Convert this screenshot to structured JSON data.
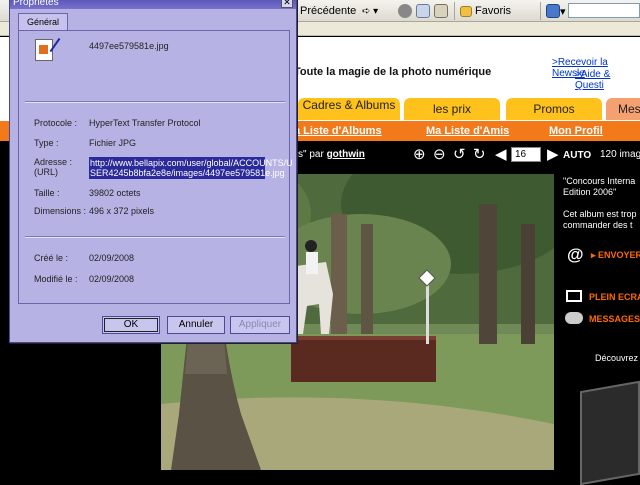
{
  "browser": {
    "back_label": "Précédente",
    "favorites_label": "Favoris"
  },
  "page": {
    "tagline": "Toute la magie de la photo numérique",
    "top_links": [
      ">Recevoir la Newsle",
      ">Aide & Questi"
    ],
    "tabs": [
      "Cadres & Albums",
      "les prix",
      "Promos",
      "Mes"
    ],
    "orange_links": [
      "a Liste d'Albums",
      "Ma Liste d'Amis",
      "Mon Profil"
    ],
    "viewer": {
      "by_prefix": "s\" par",
      "author": "gothwin",
      "page_number": "16",
      "auto_label": "AUTO",
      "image_count": "120 imag"
    },
    "right_panel": {
      "title_lines": [
        "\"Concours Interna",
        "Edition 2006\""
      ],
      "desc_lines": [
        "Cet album est trop",
        "commander des t"
      ],
      "envoyer": "ENVOYER",
      "plein_ecran": "PLEIN ECRAN",
      "messages": "MESSAGES",
      "decouvrez": "Découvrez"
    }
  },
  "dialog": {
    "title": "Propriétes",
    "tab": "Général",
    "filename": "4497ee579581e.jpg",
    "protocol": {
      "label": "Protocole :",
      "value": "HyperText Transfer Protocol"
    },
    "type": {
      "label": "Type :",
      "value": "Fichier JPG"
    },
    "address": {
      "label_lines": [
        "Adresse :",
        "(URL)"
      ],
      "value_lines": [
        "http://www.bellapix.com/user/global/ACCOUNTS/U",
        "SER4245b8bfa2e8e/images/4497ee579581e.jpg"
      ]
    },
    "size": {
      "label": "Taille :",
      "value": "39802 octets"
    },
    "dimensions": {
      "label": "Dimensions :",
      "value": "496  x  372  pixels"
    },
    "created": {
      "label": "Créé le :",
      "value": "02/09/2008"
    },
    "modified": {
      "label": "Modifié le :",
      "value": "02/09/2008"
    },
    "buttons": {
      "ok": "OK",
      "cancel": "Annuler",
      "apply": "Appliquer"
    }
  },
  "colors": {
    "dialog_bg": "#b7b2e4",
    "tab_orange": "#ffc21c",
    "nav_bar": "#f27a1a",
    "link_blue": "#0033cc",
    "action_orange": "#ff6a00"
  },
  "icons": [
    "file-jpg-icon",
    "back-arrow-icon",
    "forward-arrow-icon",
    "stop-icon",
    "refresh-icon",
    "home-icon",
    "favorites-icon",
    "mail-icon",
    "zoom-in-icon",
    "zoom-out-icon",
    "rotate-left-icon",
    "rotate-right-icon",
    "prev-icon",
    "next-icon",
    "at-icon",
    "fullscreen-icon",
    "messages-icon"
  ]
}
